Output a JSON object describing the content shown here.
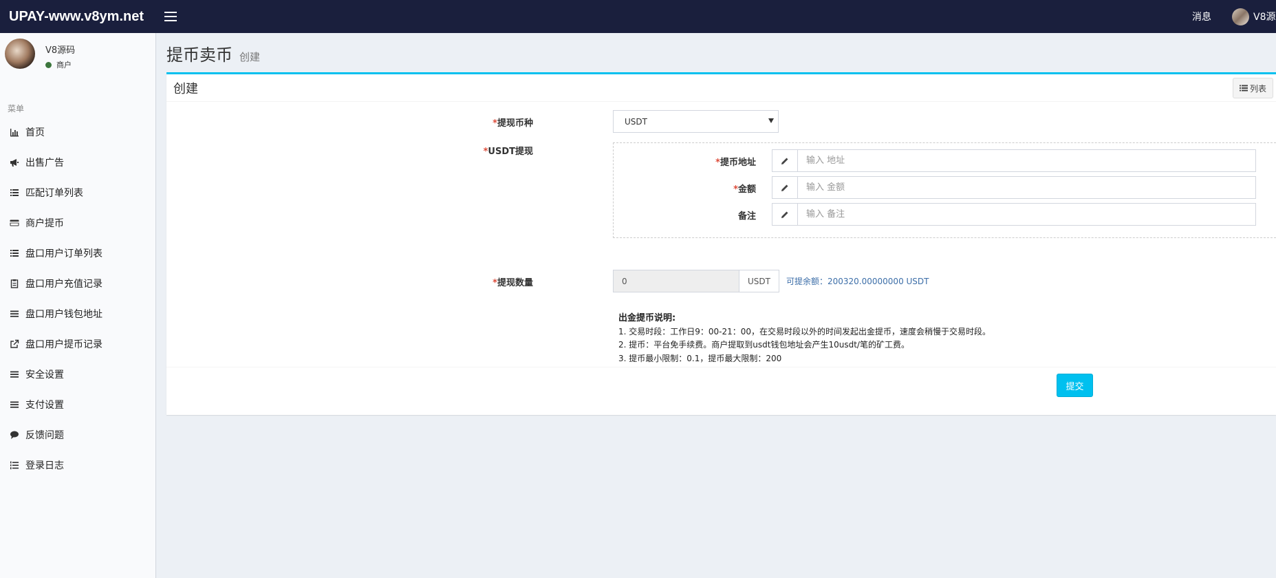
{
  "header": {
    "brand": "UPAY-www.v8ym.net",
    "messages_label": "消息",
    "user_name": "V8源"
  },
  "sidebar": {
    "user_name": "V8源码",
    "user_role": "商户",
    "menu_header": "菜单",
    "items": [
      {
        "label": "首页",
        "icon": "bar-chart-icon"
      },
      {
        "label": "出售广告",
        "icon": "bullhorn-icon"
      },
      {
        "label": "匹配订单列表",
        "icon": "list-icon"
      },
      {
        "label": "商户提币",
        "icon": "credit-card-icon"
      },
      {
        "label": "盘口用户订单列表",
        "icon": "list-icon"
      },
      {
        "label": "盘口用户充值记录",
        "icon": "clipboard-icon"
      },
      {
        "label": "盘口用户钱包地址",
        "icon": "bars-icon"
      },
      {
        "label": "盘口用户提币记录",
        "icon": "external-link-icon"
      },
      {
        "label": "安全设置",
        "icon": "bars-icon"
      },
      {
        "label": "支付设置",
        "icon": "bars-icon"
      },
      {
        "label": "反馈问题",
        "icon": "comment-icon"
      },
      {
        "label": "登录日志",
        "icon": "list-ol-icon"
      }
    ]
  },
  "page": {
    "title": "提币卖币",
    "subtitle": "创建"
  },
  "box": {
    "title": "创建",
    "list_button": "列表"
  },
  "form": {
    "currency_label": "提现币种",
    "currency_value": "USDT",
    "usdt_group_label": "USDT提现",
    "address_label": "提币地址",
    "address_placeholder": "输入 地址",
    "amount_label": "金额",
    "amount_placeholder": "输入 金额",
    "remark_label": "备注",
    "remark_placeholder": "输入 备注",
    "quantity_label": "提现数量",
    "quantity_value": "0",
    "quantity_unit": "USDT",
    "available": "可提余额：200320.00000000 USDT",
    "required_mark": "*"
  },
  "notes": {
    "title": "出金提币说明:",
    "lines": [
      "1. 交易时段：工作日9：00-21：00，在交易时段以外的时间发起出金提币，速度会稍慢于交易时段。",
      "2. 提币：平台免手续费。商户提取到usdt钱包地址会产生10usdt/笔的矿工费。",
      "3. 提币最小限制：0.1，提币最大限制：200"
    ]
  },
  "footer": {
    "submit_label": "提交"
  },
  "colors": {
    "topbar": "#1a1f3d",
    "accent": "#00c0ef",
    "required": "#dd4b39",
    "available_text": "#3c6ea8"
  }
}
